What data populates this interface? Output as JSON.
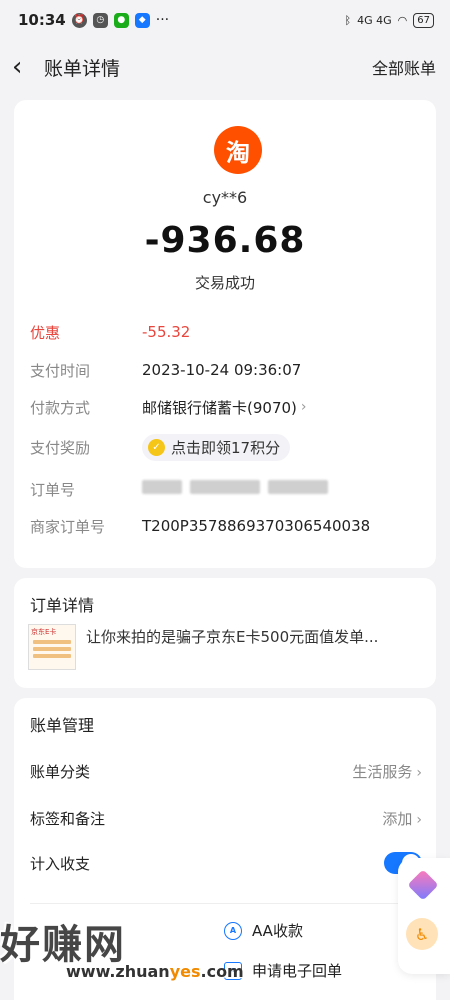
{
  "status_bar": {
    "time": "10:34",
    "more": "···",
    "signal": "4G 4G",
    "battery": "67"
  },
  "header": {
    "title": "账单详情",
    "right_link": "全部账单"
  },
  "transaction": {
    "merchant_logo": "淘",
    "merchant_name": "cy**6",
    "amount": "-936.68",
    "status": "交易成功",
    "details": [
      {
        "key": "优惠",
        "value": "-55.32"
      },
      {
        "key": "支付时间",
        "value": "2023-10-24 09:36:07"
      },
      {
        "key": "付款方式",
        "value": "邮储银行储蓄卡(9070)"
      },
      {
        "key": "支付奖励",
        "value": "点击即领17积分"
      },
      {
        "key": "订单号",
        "value": ""
      },
      {
        "key": "商家订单号",
        "value": "T200P3578869370306540038"
      }
    ]
  },
  "order": {
    "title": "订单详情",
    "thumb_label": "京东E卡",
    "description": "让你来拍的是骗子京东E卡500元面值发单..."
  },
  "manage": {
    "title": "账单管理",
    "category_label": "账单分类",
    "category_value": "生活服务",
    "tags_label": "标签和备注",
    "tags_value": "添加",
    "include_label": "计入收支",
    "actions": {
      "aa": "AA收款",
      "receipt": "申请电子回单"
    }
  },
  "watermark": {
    "text": "好赚网",
    "url_prefix": "www.zhuan",
    "url_highlight": "yes",
    "url_suffix": ".com"
  },
  "colors": {
    "accent": "#1677ff",
    "discount": "#e8453c",
    "taobao": "#ff5000"
  },
  "icons": [
    "back-chevron-icon",
    "taobao-logo-icon",
    "coin-icon",
    "chevron-right-icon",
    "aa-icon",
    "mail-icon",
    "diamond-icon",
    "accessibility-icon"
  ]
}
